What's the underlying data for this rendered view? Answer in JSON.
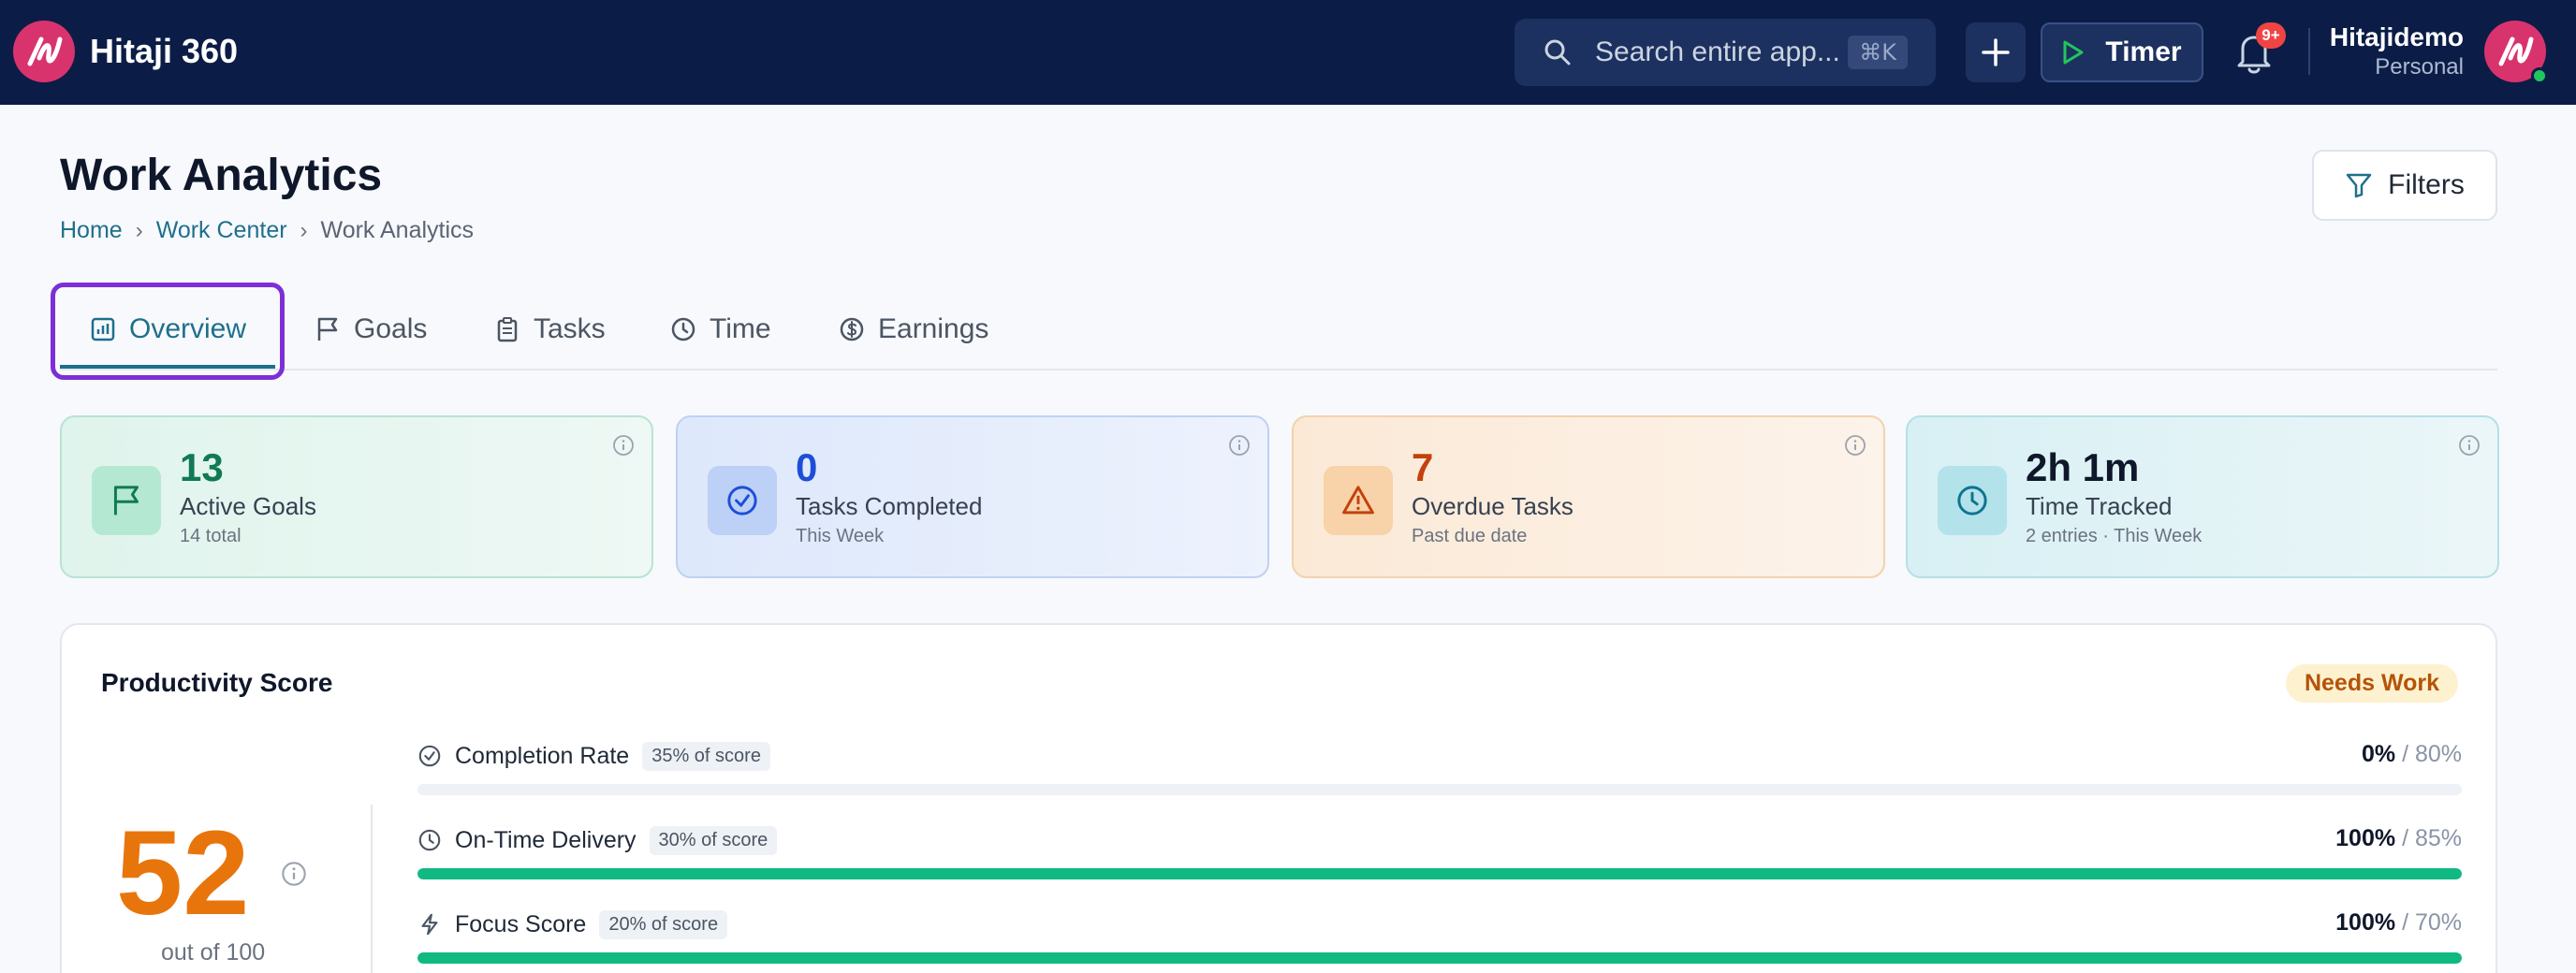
{
  "app": {
    "title": "Hitaji 360"
  },
  "search": {
    "placeholder": "Search entire app...",
    "shortcut": "⌘K"
  },
  "toolbar": {
    "timer_label": "Timer",
    "notification_badge": "9+"
  },
  "user": {
    "name": "Hitajidemo",
    "workspace": "Personal"
  },
  "page": {
    "title": "Work Analytics",
    "filters_label": "Filters",
    "breadcrumb": [
      "Home",
      "Work Center",
      "Work Analytics"
    ]
  },
  "tabs": [
    {
      "label": "Overview",
      "icon": "bar-chart-icon",
      "active": true
    },
    {
      "label": "Goals",
      "icon": "flag-icon"
    },
    {
      "label": "Tasks",
      "icon": "clipboard-icon"
    },
    {
      "label": "Time",
      "icon": "clock-icon"
    },
    {
      "label": "Earnings",
      "icon": "dollar-icon"
    }
  ],
  "stats": [
    {
      "value": "13",
      "label": "Active Goals",
      "sub": "14 total",
      "icon": "flag-icon",
      "color": "#0f7a53"
    },
    {
      "value": "0",
      "label": "Tasks Completed",
      "sub": "This Week",
      "icon": "check-circle-icon",
      "color": "#1d4ed8"
    },
    {
      "value": "7",
      "label": "Overdue Tasks",
      "sub": "Past due date",
      "icon": "warning-icon",
      "color": "#c2410c"
    },
    {
      "value": "2h 1m",
      "label": "Time Tracked",
      "sub": "2 entries · This Week",
      "icon": "clock-icon",
      "color": "#0f172a"
    }
  ],
  "productivity": {
    "title": "Productivity Score",
    "status": "Needs Work",
    "score": "52",
    "score_sub": "out of 100",
    "metrics": [
      {
        "label": "Completion Rate",
        "weight": "35% of score",
        "value": "0%",
        "target": "/ 80%",
        "progress": 0,
        "icon": "check-circle-icon"
      },
      {
        "label": "On-Time Delivery",
        "weight": "30% of score",
        "value": "100%",
        "target": "/ 85%",
        "progress": 100,
        "icon": "clock-icon"
      },
      {
        "label": "Focus Score",
        "weight": "20% of score",
        "value": "100%",
        "target": "/ 70%",
        "progress": 100,
        "icon": "lightning-icon"
      }
    ]
  },
  "colors": {
    "navbar": "#0b1d47",
    "accent": "#1f6f8b",
    "brand": "#d9336e",
    "score": "#e8750c",
    "progress": "#10b981"
  }
}
